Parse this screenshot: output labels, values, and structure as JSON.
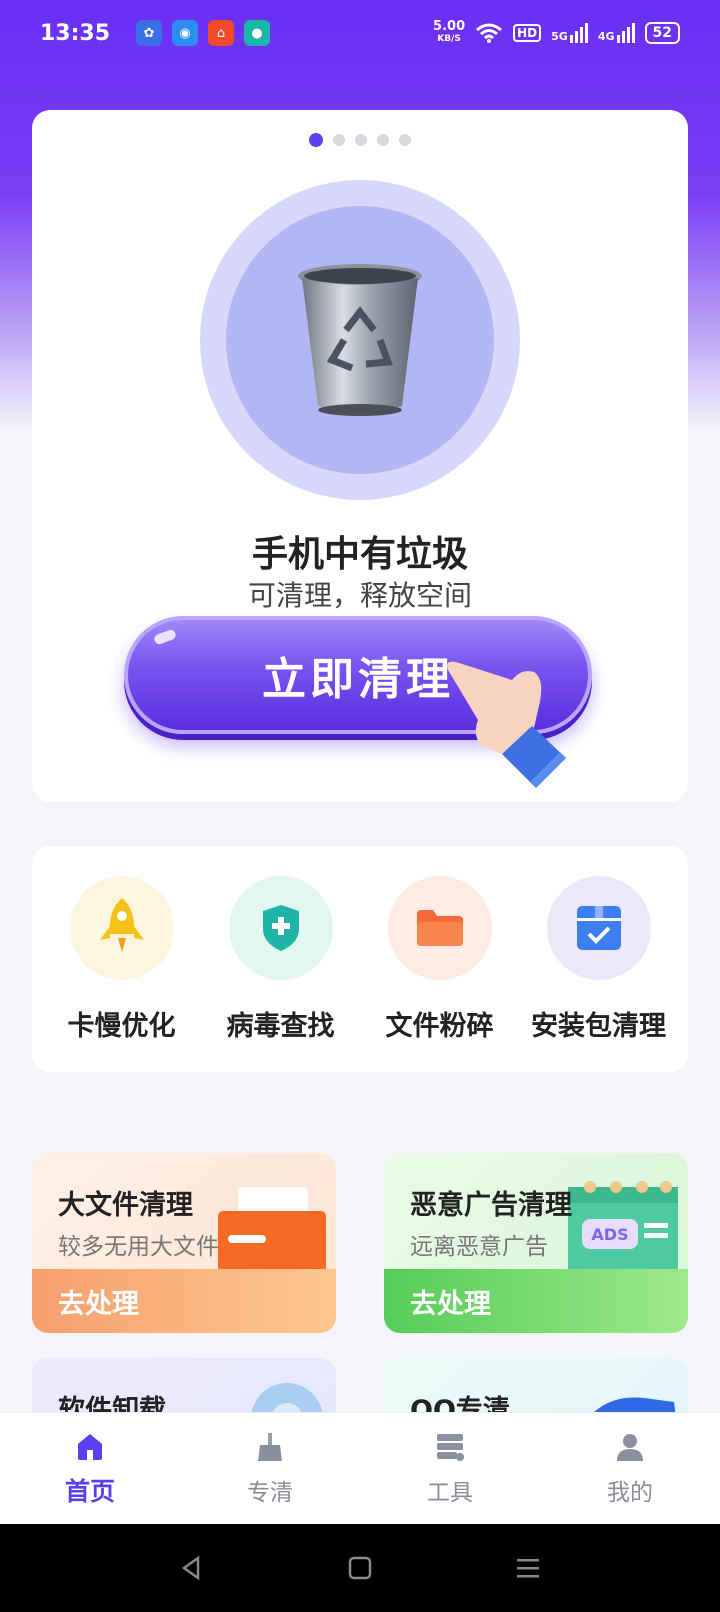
{
  "status_bar": {
    "time": "13:35",
    "net_speed": "5.00",
    "net_unit": "KB/S",
    "hd": "HD",
    "signal_5g": "5G",
    "signal_4g": "4G",
    "battery": "52"
  },
  "carousel": {
    "pages": 5,
    "active": 0
  },
  "clean_card": {
    "title": "手机中有垃圾",
    "subtitle": "可清理，释放空间",
    "button": "立即清理"
  },
  "tools": [
    {
      "label": "卡慢优化",
      "icon": "rocket-icon",
      "color": "#f6c21a",
      "bg": "#fdf6df"
    },
    {
      "label": "病毒查找",
      "icon": "shield-plus-icon",
      "color": "#1fb5a6",
      "bg": "#e2f7f1"
    },
    {
      "label": "文件粉碎",
      "icon": "folder-icon",
      "color": "#f46a3a",
      "bg": "#fdebe4"
    },
    {
      "label": "安装包清理",
      "icon": "package-check-icon",
      "color": "#3d7ff2",
      "bg": "#ece8fb"
    }
  ],
  "features": [
    {
      "title": "大文件清理",
      "subtitle": "较多无用大文件",
      "action": "去处理"
    },
    {
      "title": "恶意广告清理",
      "subtitle": "远离恶意广告",
      "action": "去处理",
      "art_text": "ADS"
    },
    {
      "title": "软件卸载"
    },
    {
      "title": "QQ专清"
    }
  ],
  "bottom_nav": [
    {
      "label": "首页",
      "icon": "home-icon",
      "active": true
    },
    {
      "label": "专清",
      "icon": "broom-icon",
      "active": false
    },
    {
      "label": "工具",
      "icon": "toolbox-icon",
      "active": false
    },
    {
      "label": "我的",
      "icon": "user-icon",
      "active": false
    }
  ]
}
